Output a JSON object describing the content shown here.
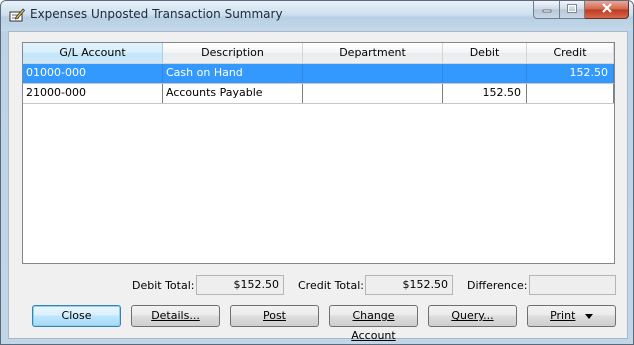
{
  "window": {
    "title": "Expenses Unposted Transaction Summary"
  },
  "grid": {
    "columns": [
      "G/L Account",
      "Description",
      "Department",
      "Debit",
      "Credit"
    ],
    "rows": [
      {
        "account": "01000-000",
        "description": "Cash on Hand",
        "department": "",
        "debit": "",
        "credit": "152.50",
        "selected": true
      },
      {
        "account": "21000-000",
        "description": "Accounts Payable",
        "department": "",
        "debit": "152.50",
        "credit": "",
        "selected": false
      }
    ]
  },
  "totals": {
    "debit_label": "Debit Total:",
    "debit_value": "$152.50",
    "credit_label": "Credit Total:",
    "credit_value": "$152.50",
    "difference_label": "Difference:",
    "difference_value": ""
  },
  "buttons": {
    "close": "Close",
    "details": "Details...",
    "post": "Post",
    "change_account": "Change Account",
    "query": "Query...",
    "print": "Print"
  },
  "colors": {
    "selection": "#3399ff",
    "window_frame": "#bcd3e6",
    "close_button": "#c0391f"
  }
}
